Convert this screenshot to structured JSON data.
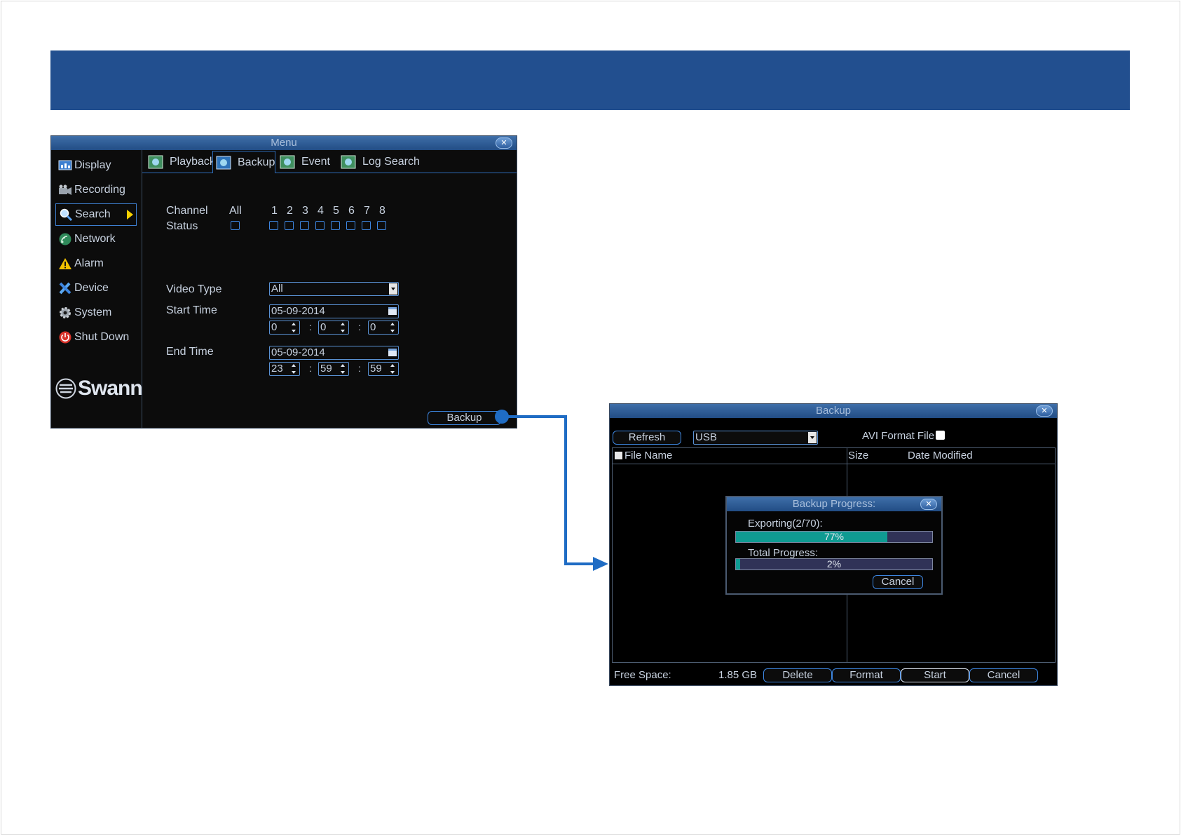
{
  "header_color": "#224f8f",
  "accent_blue": "#1f6cc4",
  "menu_window": {
    "title": "Menu",
    "close_icon": "close-icon",
    "sidebar": [
      {
        "label": "Display",
        "icon": "display-icon"
      },
      {
        "label": "Recording",
        "icon": "recording-icon"
      },
      {
        "label": "Search",
        "icon": "search-icon",
        "active": true
      },
      {
        "label": "Network",
        "icon": "network-icon"
      },
      {
        "label": "Alarm",
        "icon": "alarm-icon"
      },
      {
        "label": "Device",
        "icon": "device-icon"
      },
      {
        "label": "System",
        "icon": "system-icon"
      },
      {
        "label": "Shut Down",
        "icon": "power-icon"
      }
    ],
    "logo_text": "Swann",
    "tabs": [
      {
        "label": "Playback"
      },
      {
        "label": "Backup",
        "active": true
      },
      {
        "label": "Event"
      },
      {
        "label": "Log Search"
      }
    ],
    "channel_label": "Channel",
    "status_label": "Status",
    "channel_all_label": "All",
    "channels": [
      "1",
      "2",
      "3",
      "4",
      "5",
      "6",
      "7",
      "8"
    ],
    "video_type_label": "Video Type",
    "video_type_value": "All",
    "start_time_label": "Start Time",
    "start_date": "05-09-2014",
    "start_h": "0",
    "start_m": "0",
    "start_s": "0",
    "end_time_label": "End Time",
    "end_date": "05-09-2014",
    "end_h": "23",
    "end_m": "59",
    "end_s": "59",
    "time_sep": ":",
    "backup_button": "Backup"
  },
  "backup_window": {
    "title": "Backup",
    "refresh_button": "Refresh",
    "device_value": "USB",
    "avi_label": "AVI Format File",
    "col_file_name": "File Name",
    "col_size": "Size",
    "col_date": "Date Modified",
    "free_space_label": "Free Space:",
    "free_space_value": "1.85 GB",
    "delete_button": "Delete",
    "format_button": "Format",
    "start_button": "Start",
    "cancel_button": "Cancel"
  },
  "progress_dialog": {
    "title": "Backup Progress:",
    "exporting_label": "Exporting(2/70):",
    "exporting_percent": "77%",
    "exporting_fraction": 0.77,
    "total_label": "Total Progress:",
    "total_percent": "2%",
    "total_fraction": 0.02,
    "cancel_button": "Cancel"
  }
}
